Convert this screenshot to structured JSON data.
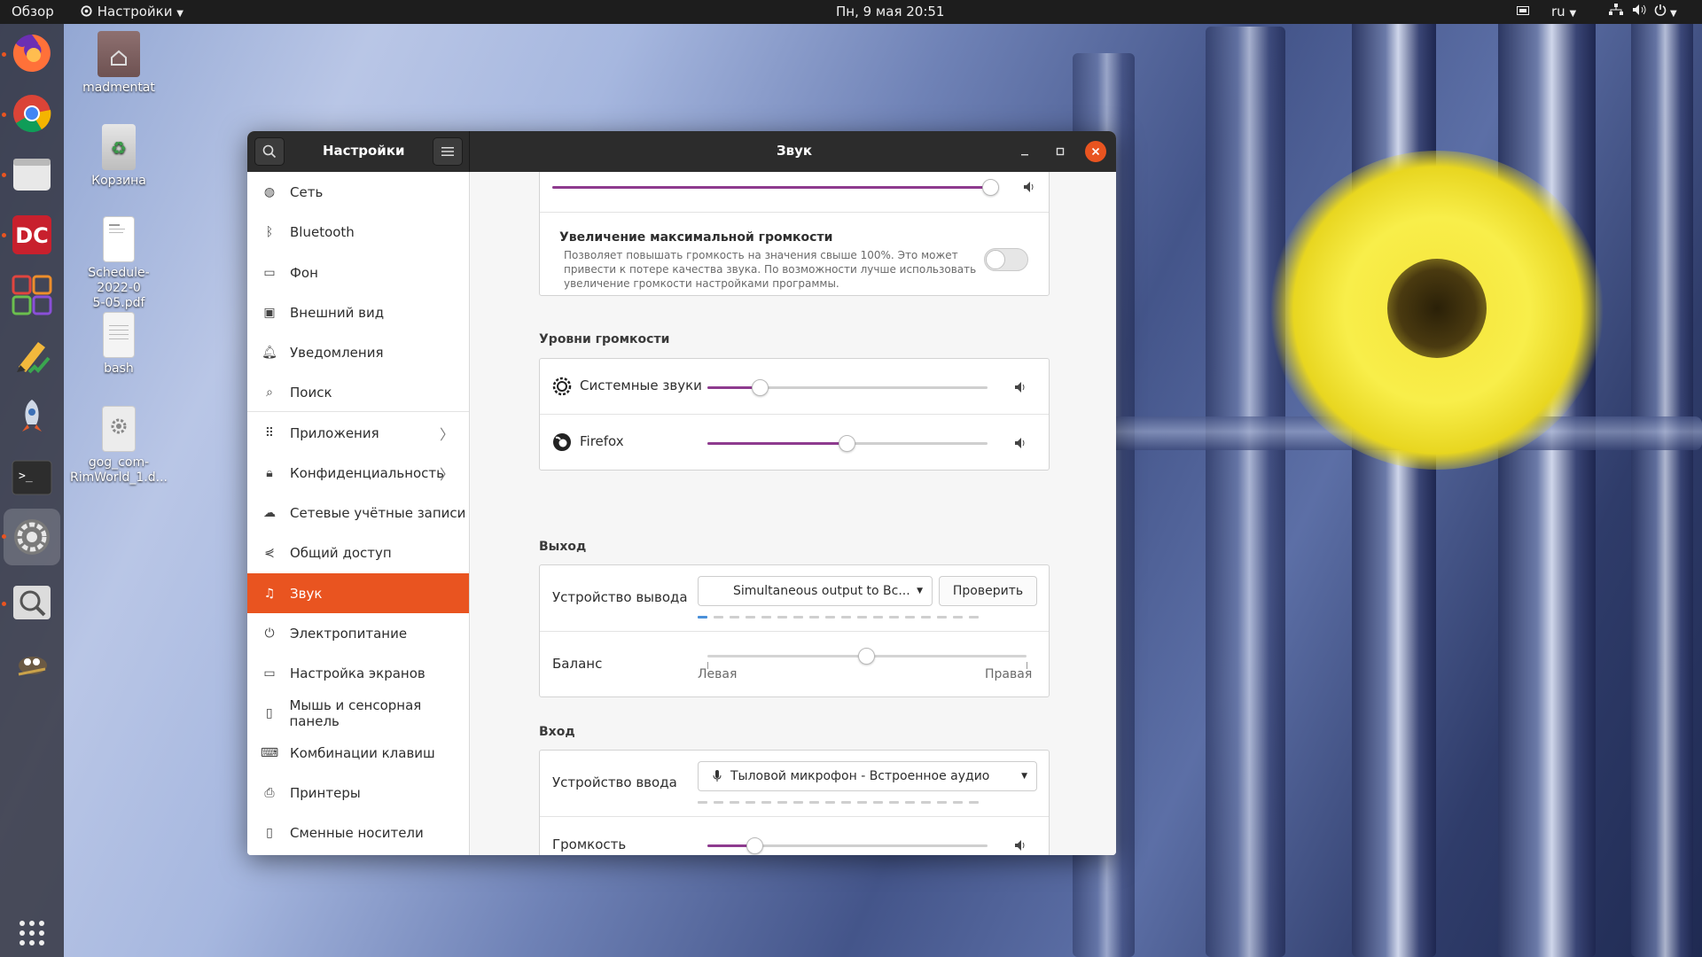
{
  "topbar": {
    "activities": "Обзор",
    "app_menu": "Настройки",
    "clock": "Пн, 9 мая  20:51",
    "keyboard_layout": "ru"
  },
  "dock": {
    "apps": [
      "firefox",
      "chrome",
      "files",
      "doublecmd",
      "calculator",
      "text-editor",
      "launcher",
      "terminal",
      "settings",
      "screenshot",
      "gimp"
    ],
    "show_apps_icon": "grid-icon"
  },
  "desktop": {
    "icons": [
      {
        "label": "madmentat",
        "icon": "home-folder-icon"
      },
      {
        "label": "Корзина",
        "icon": "trash-icon"
      },
      {
        "label": "Schedule-2022-05-05.pdf",
        "icon": "pdf-icon"
      },
      {
        "label": "bash",
        "icon": "text-file-icon"
      },
      {
        "label": "gog_com-RimWorld_1.d...",
        "icon": "gear-file-icon"
      }
    ],
    "icon_label_lines": {
      "schedule_1": "Schedule-2022-0",
      "schedule_2": "5-05.pdf",
      "gog_1": "gog_com-",
      "gog_2": "RimWorld_1.d..."
    }
  },
  "window": {
    "sidebar_title": "Настройки",
    "title": "Звук",
    "accent": "#e95420",
    "sidebar": {
      "items": [
        {
          "label": "Сеть",
          "icon": "network-icon"
        },
        {
          "label": "Bluetooth",
          "icon": "bluetooth-icon"
        },
        {
          "label": "Фон",
          "icon": "background-icon"
        },
        {
          "label": "Внешний вид",
          "icon": "appearance-icon"
        },
        {
          "label": "Уведомления",
          "icon": "bell-icon"
        },
        {
          "label": "Поиск",
          "icon": "search-icon"
        },
        {
          "label": "Приложения",
          "icon": "apps-icon"
        },
        {
          "label": "Конфиденциальность",
          "icon": "lock-icon"
        },
        {
          "label": "Сетевые учётные записи",
          "icon": "cloud-icon"
        },
        {
          "label": "Общий доступ",
          "icon": "share-icon"
        },
        {
          "label": "Звук",
          "icon": "music-note-icon"
        },
        {
          "label": "Электропитание",
          "icon": "power-icon"
        },
        {
          "label": "Настройка экранов",
          "icon": "display-icon"
        },
        {
          "label": "Мышь и сенсорная панель",
          "icon": "mouse-icon"
        },
        {
          "label": "Комбинации клавиш",
          "icon": "keyboard-icon"
        },
        {
          "label": "Принтеры",
          "icon": "printer-icon"
        },
        {
          "label": "Сменные носители",
          "icon": "removable-media-icon"
        }
      ],
      "selected": "Звук"
    },
    "sound": {
      "system_volume": 0.99,
      "overamplification": {
        "title": "Увеличение максимальной громкости",
        "description_1": "Позволяет повышать громкость на значения свыше 100%. Это может",
        "description_2": "привести к потере качества звука. По возможности лучше использовать",
        "description_3": "увеличение громкости настройками программы.",
        "enabled": false
      },
      "volume_levels": {
        "title": "Уровни громкости",
        "items": [
          {
            "label": "Системные звуки",
            "value": 0.19,
            "icon": "system-sounds-icon"
          },
          {
            "label": "Firefox",
            "value": 0.5,
            "icon": "firefox-icon"
          }
        ]
      },
      "output": {
        "title": "Выход",
        "device_label": "Устройство вывода",
        "device_value": "Simultaneous output to Вс...",
        "test_button": "Проверить",
        "level_on_segments": 1,
        "balance_label": "Баланс",
        "balance_value": 0.5,
        "balance_left": "Левая",
        "balance_right": "Правая"
      },
      "input": {
        "title": "Вход",
        "device_label": "Устройство ввода",
        "device_value": "Тыловой микрофон - Встроенное аудио",
        "volume_label": "Громкость",
        "volume_value": 0.17
      }
    }
  }
}
